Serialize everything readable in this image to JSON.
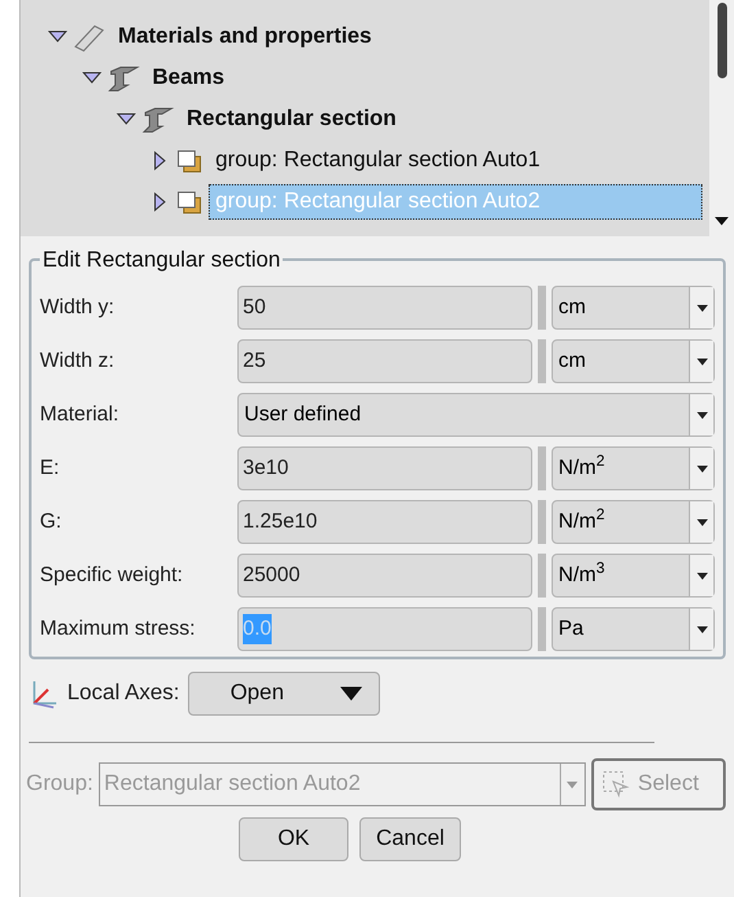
{
  "tree": [
    {
      "label": "Materials and properties",
      "kind": "bar",
      "bold": true,
      "expanded": true,
      "selected": false,
      "children": [
        {
          "label": "Beams",
          "kind": "beam",
          "bold": true,
          "expanded": true,
          "selected": false,
          "children": [
            {
              "label": "Rectangular section",
              "kind": "beam",
              "bold": true,
              "expanded": true,
              "selected": false,
              "children": [
                {
                  "label": "group: Rectangular section Auto1",
                  "kind": "group",
                  "bold": false,
                  "expanded": false,
                  "selected": false
                },
                {
                  "label": "group: Rectangular section Auto2",
                  "kind": "group",
                  "bold": false,
                  "expanded": false,
                  "selected": true
                }
              ]
            }
          ]
        }
      ]
    }
  ],
  "edit_group": {
    "title": "Edit Rectangular section",
    "fields": [
      {
        "label": "Width y:",
        "kind": "unit",
        "value": "50",
        "unit": "cm",
        "text_selected": false
      },
      {
        "label": "Width z:",
        "kind": "unit",
        "value": "25",
        "unit": "cm",
        "text_selected": false
      },
      {
        "label": "Material:",
        "kind": "combo",
        "value": "User defined"
      },
      {
        "label": "E:",
        "kind": "unit",
        "value": "3e10",
        "unit": "N/m$^{2}$",
        "text_selected": false
      },
      {
        "label": "G:",
        "kind": "unit",
        "value": "1.25e10",
        "unit": "N/m$^{2}$",
        "text_selected": false
      },
      {
        "label": "Specific weight:",
        "kind": "unit",
        "value": "25000",
        "unit": "N/m$^{3}$",
        "text_selected": false
      },
      {
        "label": "Maximum stress:",
        "kind": "unit",
        "value": "0.0",
        "unit": "Pa",
        "text_selected": true
      }
    ]
  },
  "local_axes": {
    "label": "Local Axes:",
    "button": "Open"
  },
  "group": {
    "label": "Group:",
    "value": "Rectangular section Auto2",
    "disabled": true,
    "select_button": "Select"
  },
  "buttons": [
    "OK",
    "Cancel"
  ]
}
